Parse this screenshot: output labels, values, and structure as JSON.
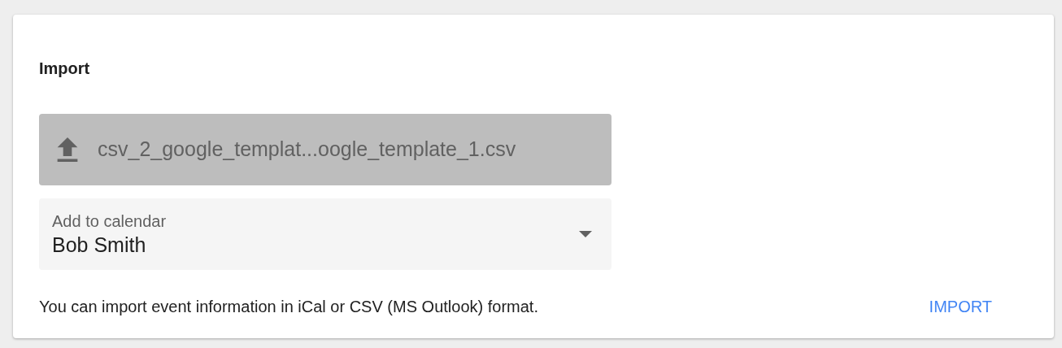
{
  "card": {
    "title": "Import",
    "file_button": {
      "label": "csv_2_google_templat...oogle_template_1.csv"
    },
    "calendar_select": {
      "label": "Add to calendar",
      "value": "Bob Smith"
    },
    "info": "You can import event information in iCal or CSV (MS Outlook) format.",
    "import_button": {
      "label": "IMPORT"
    }
  }
}
